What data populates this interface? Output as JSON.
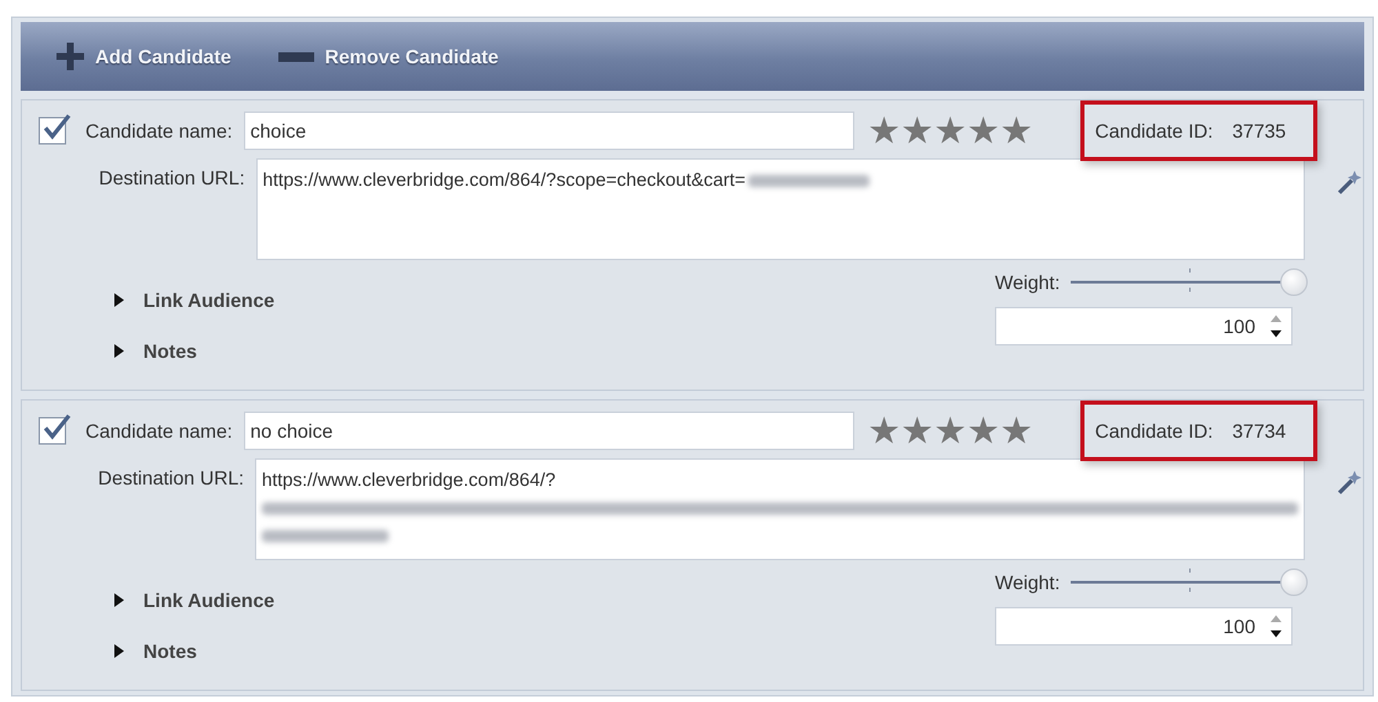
{
  "toolbar": {
    "buttons": [
      {
        "kind": "add",
        "label": "Add Candidate"
      },
      {
        "kind": "remove",
        "label": "Remove Candidate"
      }
    ]
  },
  "candidates": [
    {
      "checked": true,
      "name_label": "Candidate name:",
      "name": "choice",
      "stars": 5,
      "id_label": "Candidate ID:",
      "id": "37735",
      "id_highlighted": true,
      "url_label": "Destination URL:",
      "url": "https://www.cleverbridge.com/864/?scope=checkout&cart=",
      "kind": "inline",
      "sections": [
        {
          "label": "Link Audience",
          "expanded": false
        },
        {
          "label": "Notes",
          "expanded": false
        }
      ],
      "weight": {
        "label": "Weight:",
        "level": 1,
        "value": "100"
      }
    },
    {
      "checked": true,
      "name_label": "Candidate name:",
      "name": "no choice",
      "stars": 5,
      "id_label": "Candidate ID:",
      "id": "37734",
      "id_highlighted": true,
      "url_label": "Destination URL:",
      "url": "https://www.cleverbridge.com/864/?",
      "kind": "lines",
      "sections": [
        {
          "label": "Link Audience",
          "expanded": false
        },
        {
          "label": "Notes",
          "expanded": false
        }
      ],
      "weight": {
        "label": "Weight:",
        "level": 1,
        "value": "100"
      }
    }
  ]
}
